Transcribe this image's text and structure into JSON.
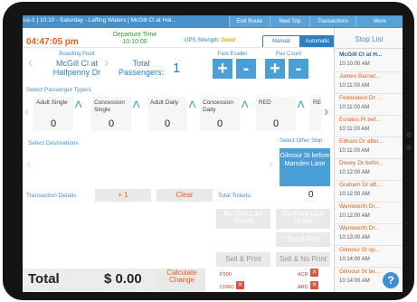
{
  "header": {
    "title": "us-1 | 10:10 - Saturday - Laffing Waters | McGill Cl at Hal...",
    "buttons": [
      "End Route",
      "Next Trip",
      "Transactions",
      "More"
    ]
  },
  "status": {
    "time": "04:47:05 pm",
    "departure_label": "Departure Time",
    "departure_time": "10:10:00",
    "gps_label": "GPS Strength:",
    "gps_value": "Good",
    "mode_manual": "Manual",
    "mode_automatic": "Automatic"
  },
  "boarding": {
    "label": "Boarding Point",
    "value": "McGill Cl at Halfpenny Dr",
    "passengers_label": "Total Passengers:",
    "passengers_value": "1",
    "fare_evader_label": "Fare Evader",
    "pax_count_label": "Pax Count",
    "plus": "+",
    "minus": "-"
  },
  "passenger_types": {
    "heading": "Select Passenger Type/s",
    "types": [
      {
        "label": "Adult Single",
        "count": "0"
      },
      {
        "label": "Concession Single",
        "count": "0"
      },
      {
        "label": "Adult Daily",
        "count": "0"
      },
      {
        "label": "Concession Daily",
        "count": "0"
      },
      {
        "label": "RED",
        "count": "0"
      },
      {
        "label": "RE",
        "count": ""
      }
    ]
  },
  "destinations": {
    "heading": "Select Destinations",
    "other_stop_label": "Select Other Stop",
    "other_stop_value": "Gilmour St before Marsden Lane"
  },
  "transaction": {
    "details_label": "Transaction Details",
    "plus_one": "+ 1",
    "clear": "Clear",
    "total_tickets_label": "Total Tickets:",
    "total_tickets_value": "0",
    "resell": "Re-Sell Last Ticket",
    "reprint": "Re-Print Last Ticket",
    "tap_pay": "Tap & Pay",
    "sell_print": "Sell & Print",
    "sell_no_print": "Sell & No Print",
    "total_label": "Total",
    "total_value": "$ 0.00",
    "calc_change": "Calculate Change",
    "codes": [
      "P200",
      "ACR",
      "CORC",
      "ARD"
    ]
  },
  "stops": {
    "title": "Stop List",
    "items": [
      {
        "name": "McGill Cl at H...",
        "time": "10:10:00 AM"
      },
      {
        "name": "James Barnet...",
        "time": "10:11:00 AM"
      },
      {
        "name": "Federation Dr ...",
        "time": "10:11:00 AM"
      },
      {
        "name": "Ecrates Pl bef...",
        "time": "10:11:00 AM"
      },
      {
        "name": "Eltham Dr after...",
        "time": "10:11:00 AM"
      },
      {
        "name": "Dovey Dr befor...",
        "time": "10:12:00 AM"
      },
      {
        "name": "Graham Dr aft...",
        "time": "10:12:00 AM"
      },
      {
        "name": "Wentworth Dr...",
        "time": "10:12:00 AM"
      },
      {
        "name": "Wentworth Dr...",
        "time": "10:13:00 AM"
      },
      {
        "name": "Gilmour St op...",
        "time": "10:14:00 AM"
      },
      {
        "name": "Gilmour St be...",
        "time": "10:14:00 AM"
      }
    ]
  },
  "help_icon": "?"
}
